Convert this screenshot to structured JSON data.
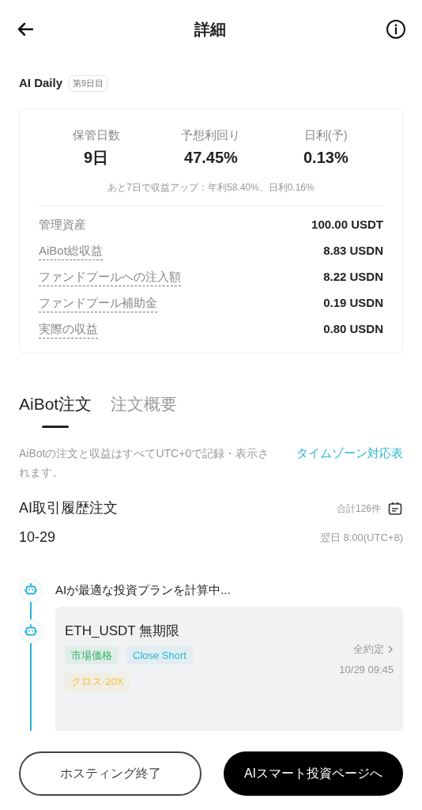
{
  "header": {
    "title": "詳細"
  },
  "plan": {
    "name": "AI Daily",
    "badge": "第9日目"
  },
  "stats": [
    {
      "label": "保管日数",
      "value": "9日"
    },
    {
      "label": "予想利回り",
      "value": "47.45%"
    },
    {
      "label": "日利(予)",
      "value": "0.13%"
    }
  ],
  "stats_note": "あと7日で収益アップ：年利58.40%、日利0.16%",
  "rows": [
    {
      "label": "管理資産",
      "value": "100.00 USDT",
      "underlined": false
    },
    {
      "label": "AiBot総収益",
      "value": "8.83 USDN",
      "underlined": true
    },
    {
      "label": "ファンドプールへの注入額",
      "value": "8.22 USDN",
      "underlined": true
    },
    {
      "label": "ファンドプール補助金",
      "value": "0.19 USDN",
      "underlined": true
    },
    {
      "label": "実際の収益",
      "value": "0.80 USDN",
      "underlined": true
    }
  ],
  "tabs": [
    {
      "label": "AiBot注文",
      "selected": true
    },
    {
      "label": "注文概要",
      "selected": false
    }
  ],
  "notice": {
    "text": "AiBotの注文と収益はすべてUTC+0で記録・表示されます。",
    "link": "タイムゾーン対応表"
  },
  "history": {
    "title": "AI取引履歴注文",
    "count": "合計126件",
    "date": "10-29",
    "time_note": "翌日 8:00(UTC+8)"
  },
  "timeline": [
    {
      "kind": "status",
      "text": "AIが最適な投資プランを計算中..."
    },
    {
      "kind": "order",
      "pair": "ETH_USDT 無期限",
      "tags": [
        {
          "label": "市場価格",
          "color": "#2fb36b"
        },
        {
          "label": "Close Short",
          "color": "#29b6d6"
        },
        {
          "label": "クロス·20X",
          "color": "#f3c13a"
        }
      ],
      "status": "全約定",
      "time": "10/29 09:45"
    }
  ],
  "buttons": [
    {
      "label": "ホスティング終了",
      "kind": "outline"
    },
    {
      "label": "AIスマート投資ページへ",
      "kind": "filled"
    }
  ]
}
